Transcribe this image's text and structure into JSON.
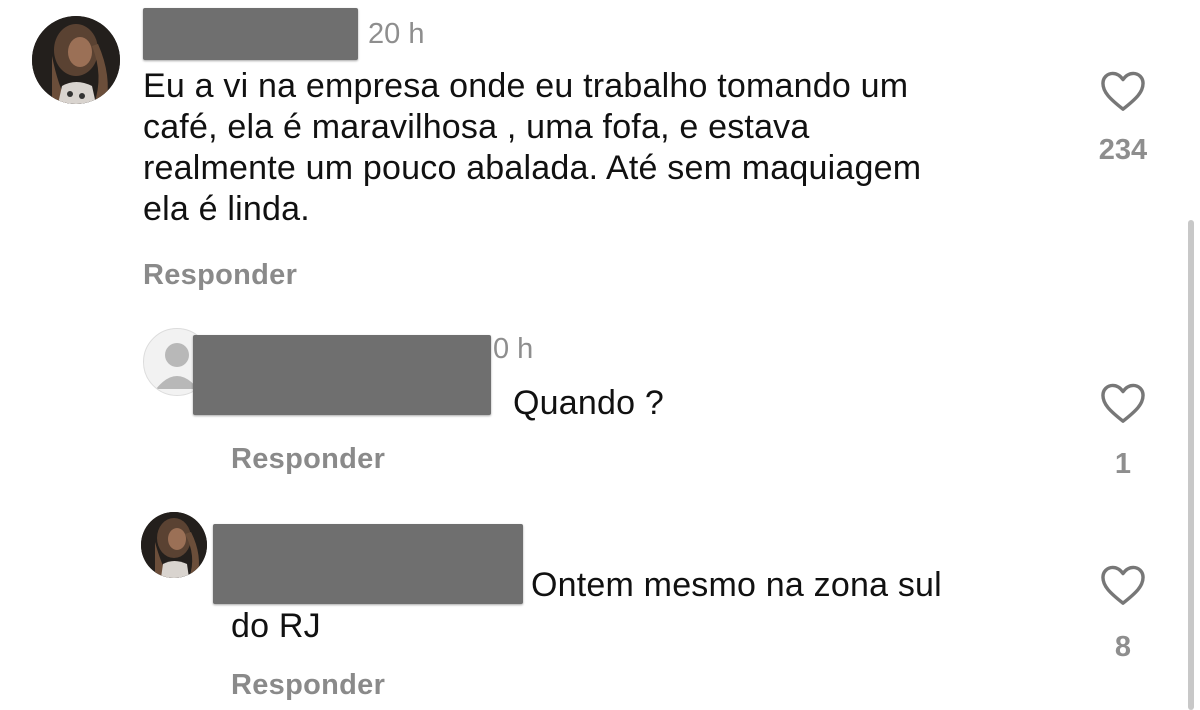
{
  "comment": {
    "time": "20 h",
    "text_lines": [
      "Eu a vi na empresa onde eu trabalho tomando um",
      "café, ela é maravilhosa , uma fofa, e estava",
      "realmente um pouco abalada. Até sem maquiagem",
      "ela é linda."
    ],
    "reply_label": "Responder",
    "likes": "234"
  },
  "reply1": {
    "time": "0 h",
    "text": "Quando ?",
    "reply_label": "Responder",
    "likes": "1"
  },
  "reply2": {
    "text_line1": "Ontem mesmo na zona sul",
    "text_line2": "do RJ",
    "reply_label": "Responder",
    "likes": "8"
  },
  "icons": {
    "like": "heart-outline-icon",
    "default_avatar": "person-placeholder-icon"
  },
  "colors": {
    "redaction": "#6f6f6f",
    "secondary_text": "#8e8e8e",
    "mention": "#3b57d6"
  }
}
